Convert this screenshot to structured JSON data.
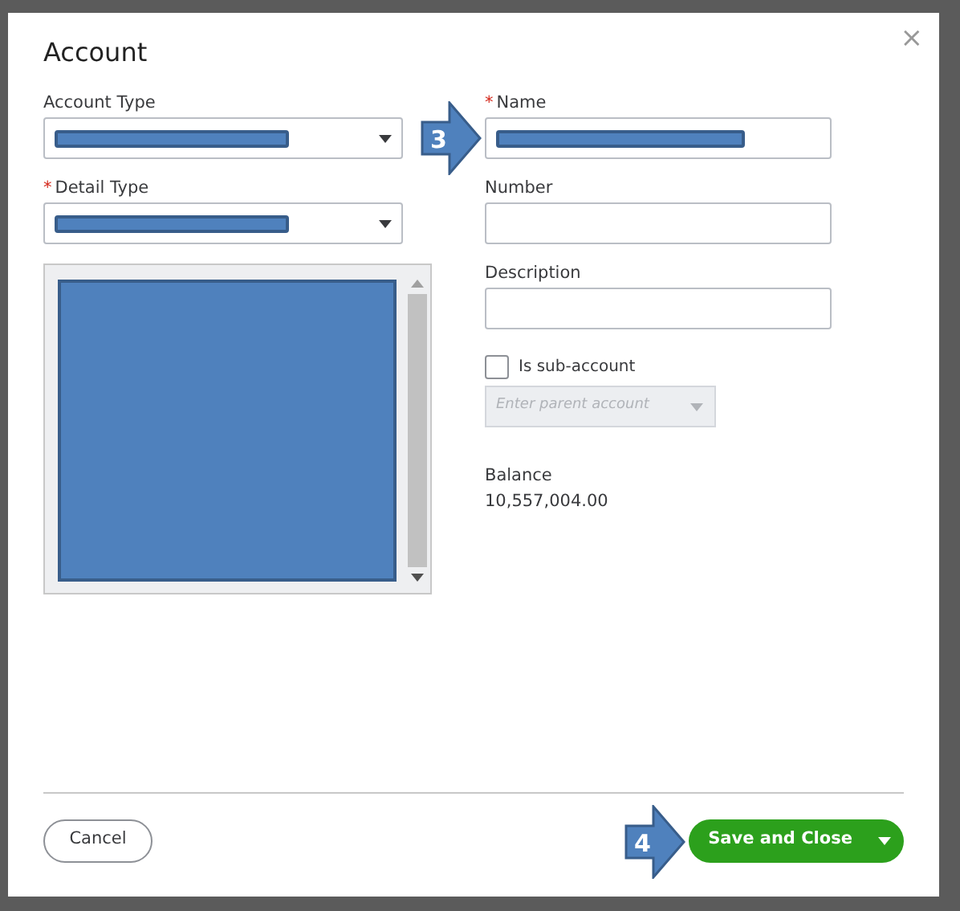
{
  "dialog": {
    "title": "Account",
    "close": "×"
  },
  "left_fields": [
    {
      "label": "Account Type",
      "value_redacted": true
    },
    {
      "label": "Detail Type",
      "required_mark": "*",
      "value_redacted": true
    }
  ],
  "detail_list": {
    "redacted": true
  },
  "right_fields": [
    {
      "label": "Name",
      "required_mark": "*",
      "value_redacted": true,
      "callout": "3"
    },
    {
      "label": "Number",
      "value_redacted": false
    },
    {
      "label": "Description",
      "value_redacted": false
    }
  ],
  "sub_account": {
    "label": "Is sub-account",
    "checked": false
  },
  "parent_account": {
    "placeholder": "Enter parent account",
    "disabled": true
  },
  "balance": {
    "label": "Balance",
    "value": "10,557,004.00"
  },
  "buttons": {
    "cancel": "Cancel",
    "save": "Save and Close",
    "save_callout": "4"
  }
}
